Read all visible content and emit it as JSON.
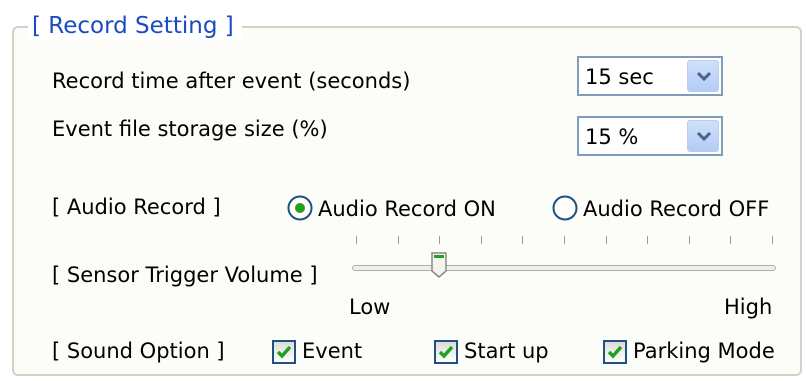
{
  "group": {
    "title": "[ Record Setting ]"
  },
  "record_time": {
    "label": "Record time after event (seconds)",
    "value": "15 sec"
  },
  "storage_size": {
    "label": "Event file storage size (%)",
    "value": "15 %"
  },
  "audio_record": {
    "label": "[ Audio Record ]",
    "options": [
      {
        "label": "Audio Record ON",
        "selected": true
      },
      {
        "label": "Audio Record OFF",
        "selected": false
      }
    ]
  },
  "sensor_trigger": {
    "label": "[ Sensor Trigger Volume ]",
    "min_label": "Low",
    "max_label": "High",
    "tick_count": 11,
    "level_fraction": 0.2
  },
  "sound_option": {
    "label": "[ Sound Option ]",
    "items": [
      {
        "label": "Event",
        "checked": true
      },
      {
        "label": "Start up",
        "checked": true
      },
      {
        "label": "Parking Mode",
        "checked": true
      }
    ]
  },
  "colors": {
    "title": "#1a4cc0",
    "check": "#21a121",
    "combo_border": "#7f9db9"
  }
}
